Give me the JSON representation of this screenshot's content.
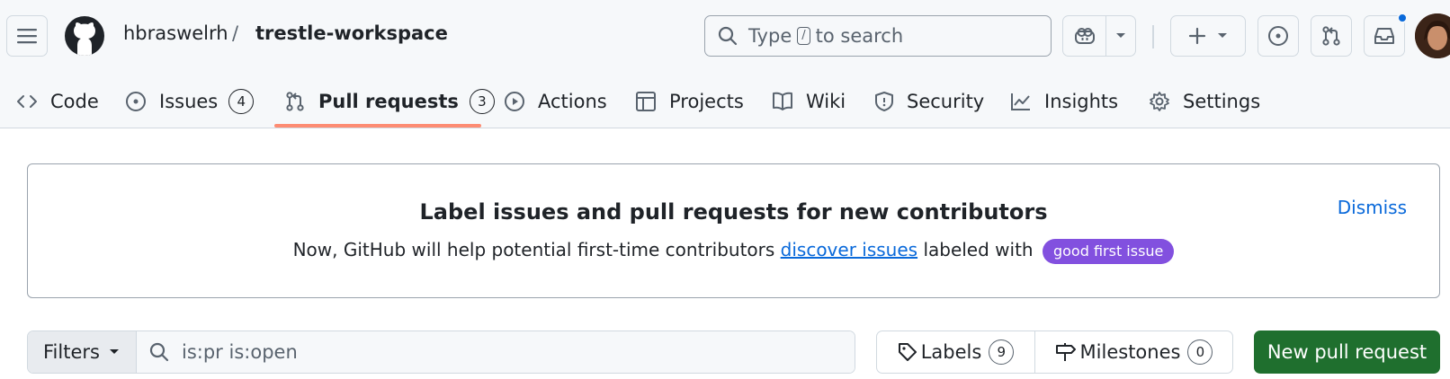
{
  "header": {
    "owner": "hbraswelrh",
    "separator": "/",
    "repo": "trestle-workspace",
    "search": {
      "prefix": "Type",
      "key": "/",
      "suffix": "to search"
    }
  },
  "tabs": [
    {
      "label": "Code",
      "icon": "code-icon"
    },
    {
      "label": "Issues",
      "icon": "issue-opened-icon",
      "count": "4"
    },
    {
      "label": "Pull requests",
      "icon": "git-pull-request-icon",
      "count": "3",
      "selected": true
    },
    {
      "label": "Actions",
      "icon": "play-icon"
    },
    {
      "label": "Projects",
      "icon": "table-icon"
    },
    {
      "label": "Wiki",
      "icon": "book-icon"
    },
    {
      "label": "Security",
      "icon": "shield-icon"
    },
    {
      "label": "Insights",
      "icon": "graph-icon"
    },
    {
      "label": "Settings",
      "icon": "gear-icon"
    }
  ],
  "banner": {
    "title": "Label issues and pull requests for new contributors",
    "text_before": "Now, GitHub will help potential first-time contributors",
    "link": "discover issues",
    "text_after": "labeled with",
    "label": "good first issue",
    "dismiss": "Dismiss"
  },
  "toolbar": {
    "filters": "Filters",
    "query": "is:pr is:open",
    "labels": "Labels",
    "labels_count": "9",
    "milestones": "Milestones",
    "milestones_count": "0",
    "new_pr": "New pull request"
  },
  "colors": {
    "accent_green": "#1f6f2e",
    "label_purple": "#8250df",
    "link_blue": "#0969da",
    "tab_underline": "#fd8c73"
  }
}
